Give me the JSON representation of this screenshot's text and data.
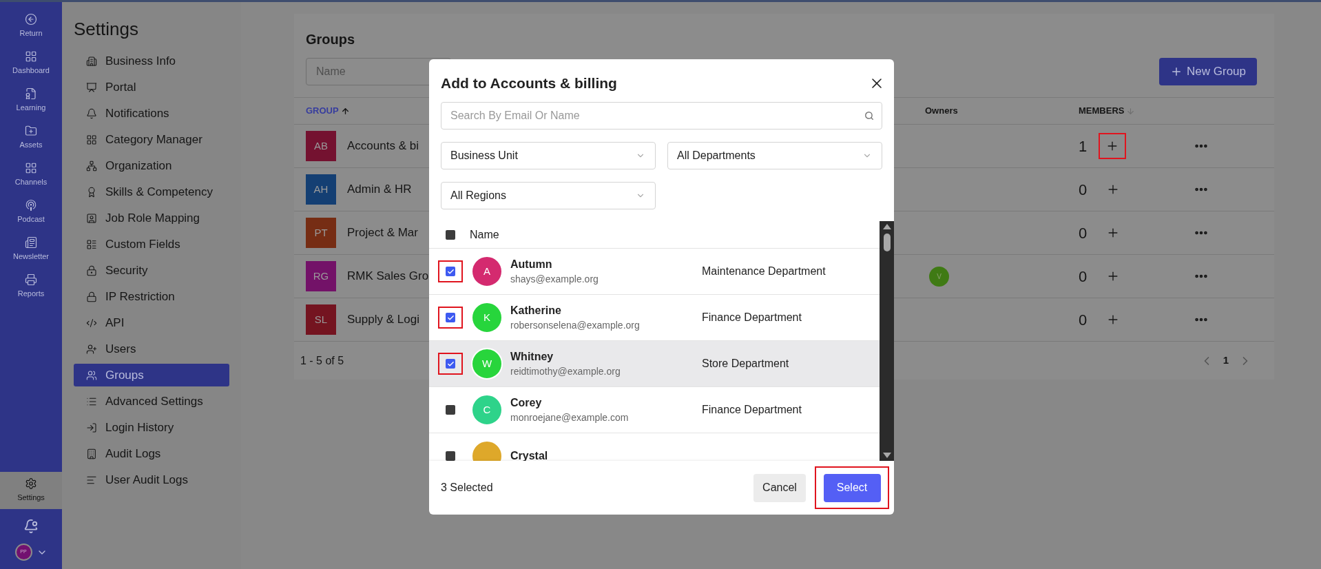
{
  "nav_rail": {
    "items": [
      {
        "label": "Return",
        "selected": false
      },
      {
        "label": "Dashboard",
        "selected": false
      },
      {
        "label": "Learning",
        "selected": false
      },
      {
        "label": "Assets",
        "selected": false
      },
      {
        "label": "Channels",
        "selected": false
      },
      {
        "label": "Podcast",
        "selected": false
      },
      {
        "label": "Newsletter",
        "selected": false
      },
      {
        "label": "Reports",
        "selected": false
      },
      {
        "label": "Settings",
        "selected": true
      }
    ],
    "user_avatar": {
      "initials": "PP"
    }
  },
  "settings_sidebar": {
    "title": "Settings",
    "items": [
      {
        "label": "Business Info",
        "selected": false
      },
      {
        "label": "Portal",
        "selected": false
      },
      {
        "label": "Notifications",
        "selected": false
      },
      {
        "label": "Category Manager",
        "selected": false
      },
      {
        "label": "Organization",
        "selected": false
      },
      {
        "label": "Skills & Competency",
        "selected": false
      },
      {
        "label": "Job Role Mapping",
        "selected": false
      },
      {
        "label": "Custom Fields",
        "selected": false
      },
      {
        "label": "Security",
        "selected": false
      },
      {
        "label": "IP Restriction",
        "selected": false
      },
      {
        "label": "API",
        "selected": false
      },
      {
        "label": "Users",
        "selected": false
      },
      {
        "label": "Groups",
        "selected": true
      },
      {
        "label": "Advanced Settings",
        "selected": false
      },
      {
        "label": "Login History",
        "selected": false
      },
      {
        "label": "Audit Logs",
        "selected": false
      },
      {
        "label": "User Audit Logs",
        "selected": false
      }
    ]
  },
  "groups": {
    "title": "Groups",
    "name_filter": {
      "placeholder": "Name"
    },
    "new_group_button": "New Group",
    "columns": [
      {
        "label": "GROUP",
        "sortable": true,
        "sort_ascending": true,
        "active": true
      },
      {
        "label": "Owners",
        "sortable": false,
        "active": false
      },
      {
        "label": "MEMBERS",
        "sortable": true,
        "sort_ascending": false,
        "active": false
      }
    ],
    "rows": [
      {
        "initials": "AB",
        "name": "Accounts & bi",
        "color": "#741230",
        "owners": [],
        "members": "1",
        "annotated": true
      },
      {
        "initials": "AH",
        "name": "Admin & HR",
        "color": "#143f73",
        "owners": [],
        "members": "0",
        "annotated": false
      },
      {
        "initials": "PT",
        "name": "Project & Mar",
        "color": "#762d14",
        "owners": [],
        "members": "0",
        "annotated": false
      },
      {
        "initials": "RG",
        "name": "RMK Sales Gro",
        "color": "#731268",
        "owners": [
          {
            "initials": "V",
            "color": "#3f7a14"
          }
        ],
        "members": "0",
        "annotated": false
      },
      {
        "initials": "SL",
        "name": "Supply & Logi",
        "color": "#741420",
        "owners": [],
        "members": "0",
        "annotated": false
      }
    ],
    "pagination": {
      "summary": "1 - 5 of 5",
      "pages": [
        {
          "label": "1",
          "selected": true
        }
      ]
    }
  },
  "dialog": {
    "title": "Add to Accounts & billing",
    "search": {
      "placeholder": "Search By Email Or Name"
    },
    "filters": [
      {
        "value": "Business Unit"
      },
      {
        "value": "All Departments"
      },
      {
        "value": "All Regions"
      }
    ],
    "header": {
      "select_all_checked": false,
      "column": "Name"
    },
    "members": [
      {
        "initials": "A",
        "name": "Autumn",
        "email": "shays@example.org",
        "department": "Maintenance Department",
        "color": "#d42a6f",
        "checked": true,
        "annotated": true,
        "hovered": false
      },
      {
        "initials": "K",
        "name": "Katherine",
        "email": "robersonselena@example.org",
        "department": "Finance Department",
        "color": "#27d53c",
        "checked": true,
        "annotated": true,
        "hovered": false
      },
      {
        "initials": "W",
        "name": "Whitney",
        "email": "reidtimothy@example.org",
        "department": "Store Department",
        "color": "#28d53c",
        "checked": true,
        "annotated": true,
        "hovered": true
      },
      {
        "initials": "C",
        "name": "Corey",
        "email": "monroejane@example.com",
        "department": "Finance Department",
        "color": "#2ed38a",
        "checked": false,
        "annotated": false,
        "hovered": false
      },
      {
        "name": "Crystal",
        "color": "#dea82a",
        "checked": false,
        "annotated": false,
        "hovered": false
      }
    ],
    "selected_count": "3 Selected",
    "cancel_button": "Cancel",
    "select_button": {
      "label": "Select",
      "annotated": true
    }
  }
}
